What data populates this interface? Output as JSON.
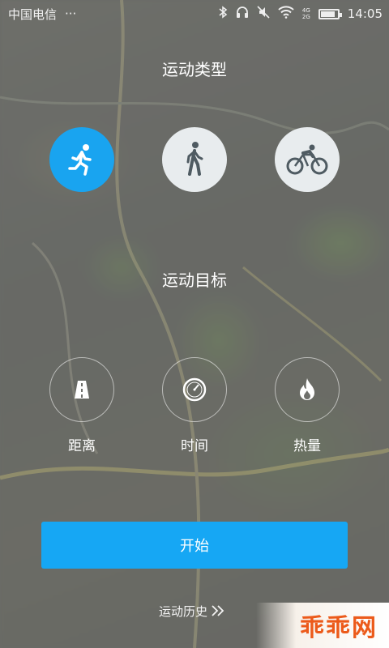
{
  "status_bar": {
    "carrier": "中国电信",
    "more": "···",
    "net_top": "4G",
    "net_bottom": "2G",
    "time": "14:05",
    "battery_level": 0.85
  },
  "sport_type": {
    "title": "运动类型",
    "options": [
      {
        "name": "run",
        "icon": "running-icon",
        "selected": true
      },
      {
        "name": "walk",
        "icon": "walking-icon",
        "selected": false
      },
      {
        "name": "bike",
        "icon": "cycling-icon",
        "selected": false
      }
    ]
  },
  "sport_goal": {
    "title": "运动目标",
    "options": [
      {
        "label": "距离",
        "icon": "road-icon"
      },
      {
        "label": "时间",
        "icon": "clock-icon"
      },
      {
        "label": "热量",
        "icon": "flame-icon"
      }
    ]
  },
  "start_label": "开始",
  "history_label": "运动历史",
  "watermark": "乖乖网",
  "colors": {
    "accent": "#19a4f0",
    "inactive_bg": "#e8ecee",
    "watermark": "#ec5a1a"
  }
}
